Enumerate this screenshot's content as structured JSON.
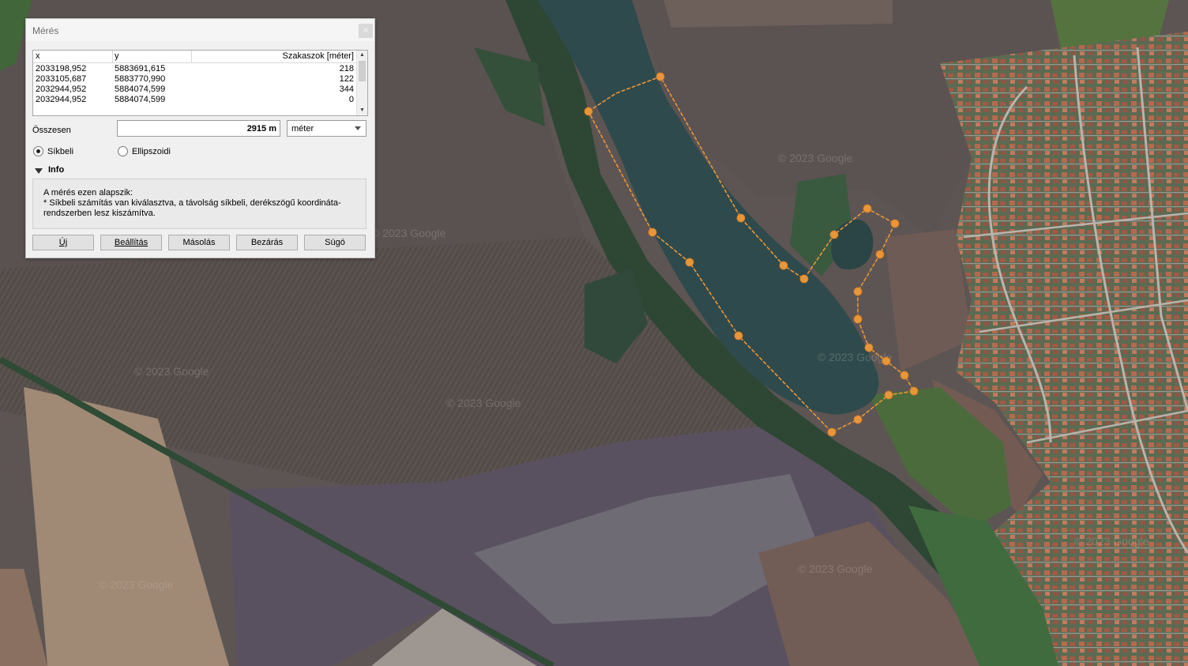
{
  "dialog": {
    "title": "Mérés",
    "close_symbol": "×",
    "table": {
      "headers": {
        "x": "x",
        "y": "y",
        "segments": "Szakaszok [méter]"
      },
      "rows": [
        {
          "x": "2033198,952",
          "y": "5883691,615",
          "d": "218"
        },
        {
          "x": "2033105,687",
          "y": "5883770,990",
          "d": "122"
        },
        {
          "x": "2032944,952",
          "y": "5884074,599",
          "d": "344"
        },
        {
          "x": "2032944,952",
          "y": "5884074,599",
          "d": "0"
        }
      ]
    },
    "total_label": "Összesen",
    "total_value": "2915 m",
    "unit": "méter",
    "radio_planar": "Síkbeli",
    "radio_ellipsoidal": "Ellipszoidi",
    "selected_radio": "planar",
    "info_header": "Info",
    "info_lines": [
      "A mérés ezen alapszik:",
      "* Síkbeli számítás van kiválasztva, a távolság síkbeli, derékszögű koordináta-",
      "rendszerben lesz kiszámítva."
    ],
    "buttons": {
      "new": "Új",
      "settings": "Beállítás",
      "copy": "Másolás",
      "close": "Bezárás",
      "help": "Súgó"
    }
  },
  "map": {
    "measure_color": "#e8963a",
    "water_color": "#2f4a4c",
    "watermarks": [
      "© 2023 Google",
      "© 2023 Google",
      "© 2023 Google",
      "© 2023 Google",
      "© 2023 Google",
      "© 2023 Google",
      "© 2023 Google",
      "© 2023 Google"
    ]
  }
}
